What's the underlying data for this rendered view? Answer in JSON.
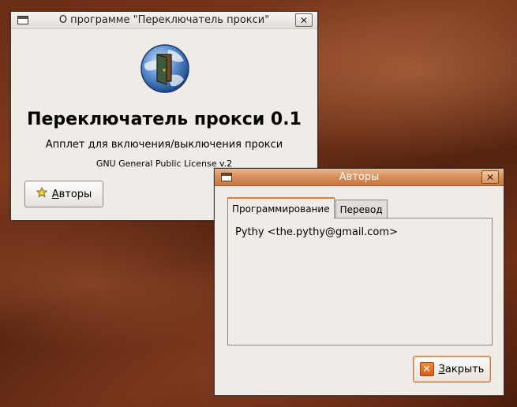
{
  "about_window": {
    "title": "О программе \"Переключатель прокси\"",
    "close_glyph": "✕",
    "app_name": "Переключатель прокси 0.1",
    "description": "Апплет для включения/выключения прокси",
    "license": "GNU General Public License v.2",
    "credits_button": "Авторы",
    "logo_icon": "globe-door-icon"
  },
  "authors_window": {
    "title": "Авторы",
    "close_glyph": "✕",
    "tabs": [
      {
        "label": "Программирование",
        "active": true
      },
      {
        "label": "Перевод",
        "active": false
      }
    ],
    "content": "Pythy <the.pythy@gmail.com>",
    "close_button": "Закрыть",
    "close_button_icon": "close-icon"
  },
  "colors": {
    "active_titlebar": "#d48b55",
    "window_bg": "#efebe7",
    "desktop": "#6a2e16"
  }
}
